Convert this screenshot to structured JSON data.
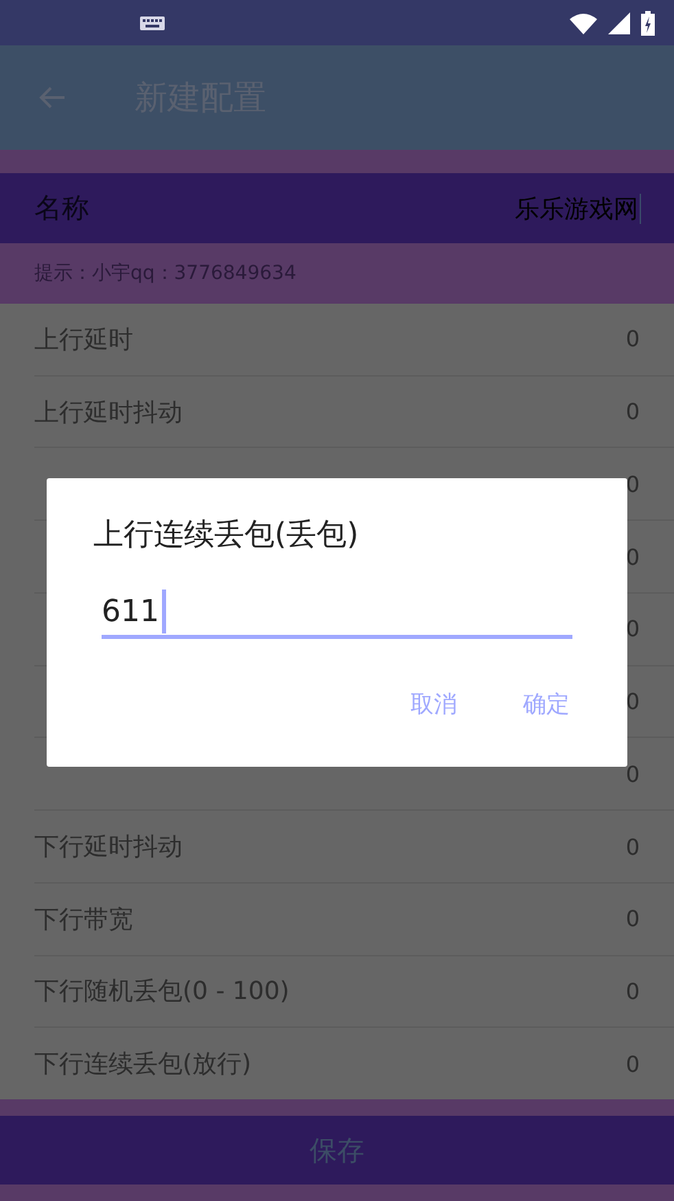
{
  "app_bar": {
    "title": "新建配置"
  },
  "name_field": {
    "label": "名称",
    "value": "乐乐游戏网"
  },
  "hint": "提示：小宇qq：3776849634",
  "settings": [
    {
      "label": "上行延时",
      "value": "0"
    },
    {
      "label": "上行延时抖动",
      "value": "0"
    },
    {
      "value": "0"
    },
    {
      "value": "0"
    },
    {
      "value": "0"
    },
    {
      "value": "0"
    },
    {
      "value": "0"
    },
    {
      "label": "下行延时抖动",
      "value": "0"
    },
    {
      "label": "下行带宽",
      "value": "0"
    },
    {
      "label": "下行随机丢包(0 - 100)",
      "value": "0"
    },
    {
      "label": "下行连续丢包(放行)",
      "value": "0"
    }
  ],
  "dialog": {
    "title": "上行连续丢包(丢包)",
    "value": "611",
    "buttons": [
      "取消",
      "确定"
    ]
  },
  "save_button": "保存"
}
